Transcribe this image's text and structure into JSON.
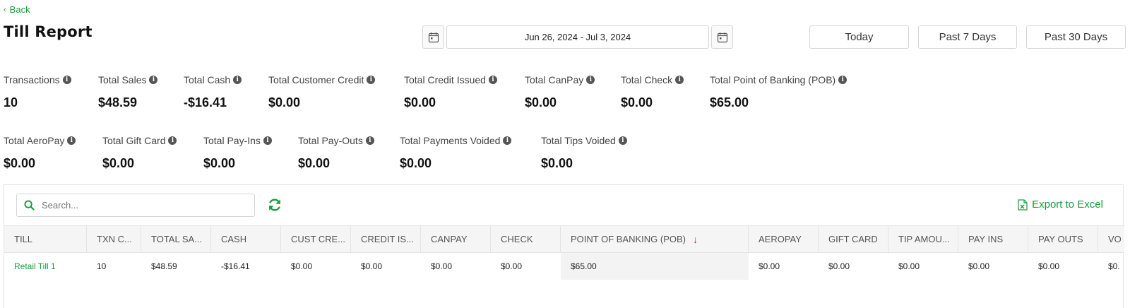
{
  "nav": {
    "back_label": "Back"
  },
  "page_title": "Till Report",
  "date_range": {
    "value": "Jun 26, 2024 - Jul 3, 2024"
  },
  "range_buttons": [
    "Today",
    "Past 7 Days",
    "Past 30 Days"
  ],
  "stats_row1": [
    {
      "label": "Transactions",
      "value": "10"
    },
    {
      "label": "Total Sales",
      "value": "$48.59"
    },
    {
      "label": "Total Cash",
      "value": "-$16.41"
    },
    {
      "label": "Total Customer Credit",
      "value": "$0.00"
    },
    {
      "label": "Total Credit Issued",
      "value": "$0.00"
    },
    {
      "label": "Total CanPay",
      "value": "$0.00"
    },
    {
      "label": "Total Check",
      "value": "$0.00"
    },
    {
      "label": "Total Point of Banking (POB)",
      "value": "$65.00"
    }
  ],
  "stats_row2": [
    {
      "label": "Total AeroPay",
      "value": "$0.00"
    },
    {
      "label": "Total Gift Card",
      "value": "$0.00"
    },
    {
      "label": "Total Pay-Ins",
      "value": "$0.00"
    },
    {
      "label": "Total Pay-Outs",
      "value": "$0.00"
    },
    {
      "label": "Total Payments Voided",
      "value": "$0.00"
    },
    {
      "label": "Total Tips Voided",
      "value": "$0.00"
    }
  ],
  "search": {
    "placeholder": "Search..."
  },
  "export_label": "Export to Excel",
  "table": {
    "columns": [
      "TILL",
      "TXN C...",
      "TOTAL SA...",
      "CASH",
      "CUST CRE...",
      "CREDIT IS...",
      "CANPAY",
      "CHECK",
      "POINT OF BANKING (POB)",
      "AEROPAY",
      "GIFT CARD",
      "TIP AMOU...",
      "PAY INS",
      "PAY OUTS",
      "VO"
    ],
    "sorted_column": "POINT OF BANKING (POB)",
    "sort_direction": "descending",
    "rows": [
      [
        "Retail Till 1",
        "10",
        "$48.59",
        "-$16.41",
        "$0.00",
        "$0.00",
        "$0.00",
        "$0.00",
        "$65.00",
        "$0.00",
        "$0.00",
        "$0.00",
        "$0.00",
        "$0.00",
        "$0."
      ]
    ]
  },
  "colors": {
    "accent_green": "#1a9a3c",
    "sort_arrow": "#dd2222"
  },
  "icons": {
    "back": "chevron-left-icon",
    "calendar": "calendar-icon",
    "info": "info-icon",
    "search": "search-icon",
    "refresh": "refresh-icon",
    "export": "excel-icon",
    "sort": "arrow-down-icon"
  }
}
